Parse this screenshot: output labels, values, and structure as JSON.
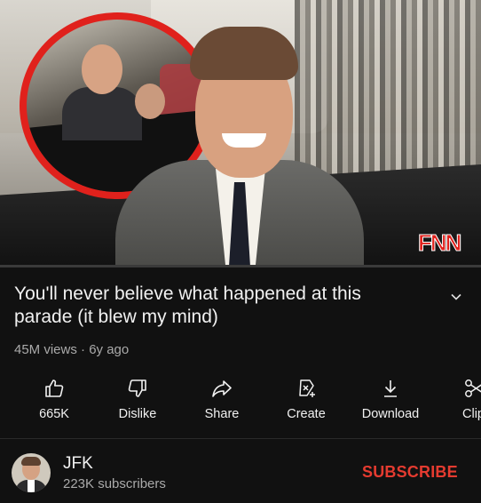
{
  "thumbnail": {
    "watermark": "FNN"
  },
  "video": {
    "title": "You'll never believe what happened at this parade (it blew my mind)",
    "views": "45M views",
    "age": "6y ago"
  },
  "actions": {
    "like": {
      "label": "665K",
      "icon": "thumbs-up-icon"
    },
    "dislike": {
      "label": "Dislike",
      "icon": "thumbs-down-icon"
    },
    "share": {
      "label": "Share",
      "icon": "share-arrow-icon"
    },
    "create": {
      "label": "Create",
      "icon": "create-icon"
    },
    "download": {
      "label": "Download",
      "icon": "download-icon"
    },
    "clip": {
      "label": "Clip",
      "icon": "scissors-icon"
    }
  },
  "channel": {
    "name": "JFK",
    "subscribers": "223K subscribers",
    "subscribe_label": "SUBSCRIBE"
  },
  "colors": {
    "background": "#111111",
    "text": "#f1f1f1",
    "secondary_text": "#aaaaaa",
    "subscribe": "#e53b30",
    "circle_highlight": "#e0211c"
  }
}
